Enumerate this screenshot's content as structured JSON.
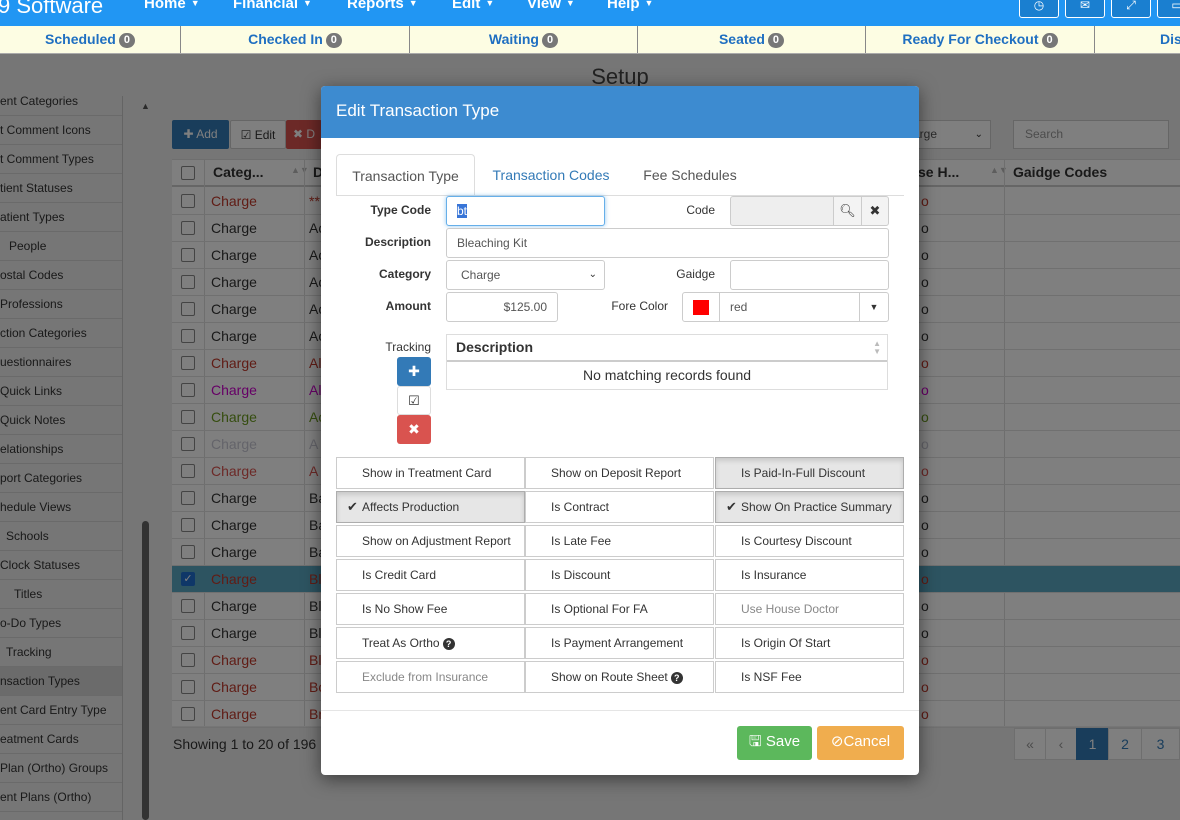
{
  "nav": {
    "brand": "9 Software",
    "menus": [
      "Home",
      "Financial",
      "Reports",
      "Edit",
      "View",
      "Help"
    ],
    "icon_buttons": [
      "clock-icon",
      "envelope-icon",
      "expand-icon",
      "window-icon"
    ]
  },
  "statusbar": [
    {
      "label": "Scheduled",
      "count": "0"
    },
    {
      "label": "Checked In",
      "count": "0"
    },
    {
      "label": "Waiting",
      "count": "0"
    },
    {
      "label": "Seated",
      "count": "0"
    },
    {
      "label": "Ready For Checkout",
      "count": "0"
    },
    {
      "label": "Dis",
      "count": ""
    }
  ],
  "page": {
    "title": "Setup",
    "sidebar": [
      "ent Categories",
      "t Comment Icons",
      "t Comment Types",
      "tient Statuses",
      "atient Types",
      "People",
      "ostal Codes",
      "Professions",
      "ction Categories",
      "uestionnaires",
      "Quick Links",
      "Quick Notes",
      "elationships",
      "port Categories",
      "hedule Views",
      "Schools",
      "Clock Statuses",
      "Titles",
      "o-Do Types",
      "Tracking",
      "nsaction Types",
      "ent Card Entry Type",
      "eatment Cards",
      "Plan (Ortho) Groups",
      "ent Plans (Ortho)"
    ],
    "sidebar_active_index": 20,
    "toolbar": {
      "add": "Add",
      "edit": "Edit",
      "delete": "D",
      "search_placeholder": "Search",
      "select_value": "arge"
    },
    "grid": {
      "headers": {
        "category": "Categ...",
        "desc": "D",
        "house": "se H...",
        "gaidge": "Gaidge Codes"
      },
      "rows": [
        {
          "category": "Charge",
          "color": "#c0392b",
          "d": "**",
          "checked": false
        },
        {
          "category": "Charge",
          "color": "#333333",
          "d": "Ac",
          "checked": false
        },
        {
          "category": "Charge",
          "color": "#333333",
          "d": "Ac",
          "checked": false
        },
        {
          "category": "Charge",
          "color": "#333333",
          "d": "Ac",
          "checked": false
        },
        {
          "category": "Charge",
          "color": "#333333",
          "d": "Ac",
          "checked": false
        },
        {
          "category": "Charge",
          "color": "#333333",
          "d": "Ac",
          "checked": false
        },
        {
          "category": "Charge",
          "color": "#c0392b",
          "d": "Al",
          "checked": false
        },
        {
          "category": "Charge",
          "color": "#cc00cc",
          "d": "Al",
          "checked": false
        },
        {
          "category": "Charge",
          "color": "#6b9a1f",
          "d": "Ac",
          "checked": false
        },
        {
          "category": "Charge",
          "color": "#c8c8d4",
          "d": "A",
          "checked": false
        },
        {
          "category": "Charge",
          "color": "#d9534f",
          "d": "A",
          "checked": false
        },
        {
          "category": "Charge",
          "color": "#333333",
          "d": "Ba",
          "checked": false
        },
        {
          "category": "Charge",
          "color": "#333333",
          "d": "Ba",
          "checked": false
        },
        {
          "category": "Charge",
          "color": "#333333",
          "d": "Ba",
          "checked": false
        },
        {
          "category": "Charge",
          "color": "#c0392b",
          "d": "Bl",
          "checked": true
        },
        {
          "category": "Charge",
          "color": "#333333",
          "d": "Bl",
          "checked": false
        },
        {
          "category": "Charge",
          "color": "#333333",
          "d": "Bl",
          "checked": false
        },
        {
          "category": "Charge",
          "color": "#c0392b",
          "d": "Bl",
          "checked": false
        },
        {
          "category": "Charge",
          "color": "#c0392b",
          "d": "Bo",
          "checked": false
        },
        {
          "category": "Charge",
          "color": "#c0392b",
          "d": "Br",
          "checked": false
        }
      ]
    },
    "footer": "Showing 1 to 20 of 196",
    "pager": [
      "«",
      "‹",
      "1",
      "2",
      "3"
    ]
  },
  "modal": {
    "title": "Edit Transaction Type",
    "tabs": [
      "Transaction Type",
      "Transaction Codes",
      "Fee Schedules"
    ],
    "active_tab": 0,
    "fields": {
      "type_code_label": "Type Code",
      "type_code_value": "bt",
      "code_label": "Code",
      "code_value": "",
      "description_label": "Description",
      "description_value": "Bleaching Kit",
      "category_label": "Category",
      "category_value": "Charge",
      "gaidge_label": "Gaidge",
      "gaidge_value": "",
      "amount_label": "Amount",
      "amount_value": "$125.00",
      "fore_color_label": "Fore Color",
      "fore_color_value": "red",
      "fore_color_hex": "#ff0000"
    },
    "tracking": {
      "label": "Tracking",
      "column": "Description",
      "empty": "No matching records found"
    },
    "toggles": [
      {
        "label": "Show in Treatment Card",
        "on": false,
        "disabled": false,
        "help": false
      },
      {
        "label": "Show on Deposit Report",
        "on": false,
        "disabled": false,
        "help": false
      },
      {
        "label": "Is Paid-In-Full Discount",
        "on": true,
        "disabled": false,
        "help": false,
        "checkmark": false
      },
      {
        "label": "Affects Production",
        "on": true,
        "disabled": false,
        "help": false,
        "checkmark": true
      },
      {
        "label": "Is Contract",
        "on": false,
        "disabled": false,
        "help": false
      },
      {
        "label": "Show On Practice Summary",
        "on": true,
        "disabled": false,
        "help": false,
        "checkmark": true
      },
      {
        "label": "Show on Adjustment Report",
        "on": false,
        "disabled": false,
        "help": false
      },
      {
        "label": "Is Late Fee",
        "on": false,
        "disabled": false,
        "help": false
      },
      {
        "label": "Is Courtesy Discount",
        "on": false,
        "disabled": false,
        "help": false
      },
      {
        "label": "Is Credit Card",
        "on": false,
        "disabled": false,
        "help": false
      },
      {
        "label": "Is Discount",
        "on": false,
        "disabled": false,
        "help": false
      },
      {
        "label": "Is Insurance",
        "on": false,
        "disabled": false,
        "help": false
      },
      {
        "label": "Is No Show Fee",
        "on": false,
        "disabled": false,
        "help": false
      },
      {
        "label": "Is Optional For FA",
        "on": false,
        "disabled": false,
        "help": false
      },
      {
        "label": "Use House Doctor",
        "on": false,
        "disabled": true,
        "help": false
      },
      {
        "label": "Treat As Ortho",
        "on": false,
        "disabled": false,
        "help": true
      },
      {
        "label": "Is Payment Arrangement",
        "on": false,
        "disabled": false,
        "help": false
      },
      {
        "label": "Is Origin Of Start",
        "on": false,
        "disabled": false,
        "help": false
      },
      {
        "label": "Exclude from Insurance",
        "on": false,
        "disabled": true,
        "help": false
      },
      {
        "label": "Show on Route Sheet",
        "on": false,
        "disabled": false,
        "help": true
      },
      {
        "label": "Is NSF Fee",
        "on": false,
        "disabled": false,
        "help": false
      }
    ],
    "buttons": {
      "save": "Save",
      "cancel": "Cancel"
    },
    "colors": {
      "header": "#3d8bd0",
      "save": "#5cb85c",
      "cancel": "#f0ad4e",
      "add_tracking": "#337ab7",
      "delete_tracking": "#d9534f"
    }
  }
}
